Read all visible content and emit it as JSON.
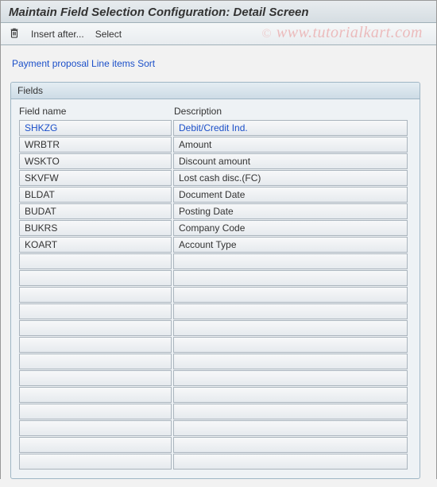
{
  "title": "Maintain Field Selection Configuration: Detail Screen",
  "toolbar": {
    "delete_tooltip": "Delete",
    "insert_after": "Insert after...",
    "select": "Select"
  },
  "breadcrumb": "Payment proposal Line items Sort",
  "panel": {
    "title": "Fields",
    "col1_header": "Field name",
    "col2_header": "Description",
    "rows": [
      {
        "name": "SHKZG",
        "desc": "Debit/Credit Ind.",
        "selected": true
      },
      {
        "name": "WRBTR",
        "desc": "Amount"
      },
      {
        "name": "WSKTO",
        "desc": "Discount amount"
      },
      {
        "name": "SKVFW",
        "desc": "Lost cash disc.(FC)"
      },
      {
        "name": "BLDAT",
        "desc": "Document Date"
      },
      {
        "name": "BUDAT",
        "desc": "Posting Date"
      },
      {
        "name": "BUKRS",
        "desc": "Company Code"
      },
      {
        "name": "KOART",
        "desc": "Account Type"
      },
      {
        "name": "",
        "desc": ""
      },
      {
        "name": "",
        "desc": ""
      },
      {
        "name": "",
        "desc": ""
      },
      {
        "name": "",
        "desc": ""
      },
      {
        "name": "",
        "desc": ""
      },
      {
        "name": "",
        "desc": ""
      },
      {
        "name": "",
        "desc": ""
      },
      {
        "name": "",
        "desc": ""
      },
      {
        "name": "",
        "desc": ""
      },
      {
        "name": "",
        "desc": ""
      },
      {
        "name": "",
        "desc": ""
      },
      {
        "name": "",
        "desc": ""
      },
      {
        "name": "",
        "desc": ""
      }
    ]
  },
  "watermark": {
    "copy": "©",
    "text": "www.tutorialkart.com"
  }
}
